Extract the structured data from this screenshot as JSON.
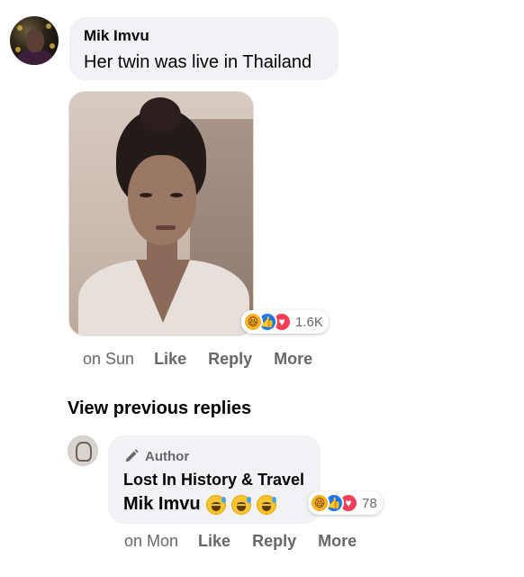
{
  "comment": {
    "author": "Mik Imvu",
    "text": "Her twin was live in Thailand",
    "reactions": {
      "icons": [
        "haha-icon",
        "like-icon",
        "love-icon"
      ],
      "count": "1.6K"
    },
    "timestamp": "on Sun",
    "actions": {
      "like": "Like",
      "reply": "Reply",
      "more": "More"
    }
  },
  "view_previous_replies": "View previous replies",
  "reply": {
    "badge": "Author",
    "author": "Lost In History & Travel",
    "mention": "Mik Imvu",
    "emojis": [
      "grinning-sweat-emoji",
      "grinning-sweat-emoji",
      "grinning-sweat-emoji"
    ],
    "reactions": {
      "icons": [
        "haha-icon",
        "like-icon",
        "love-icon"
      ],
      "count": "78"
    },
    "timestamp": "on Mon",
    "actions": {
      "like": "Like",
      "reply": "Reply",
      "more": "More"
    }
  },
  "colors": {
    "bubble_bg": "#f0f2f5",
    "secondary_text": "#65676b",
    "primary_text": "#050505",
    "like_blue": "#1877f2",
    "love_red": "#f33e58",
    "haha_yellow": "#f7b125"
  }
}
